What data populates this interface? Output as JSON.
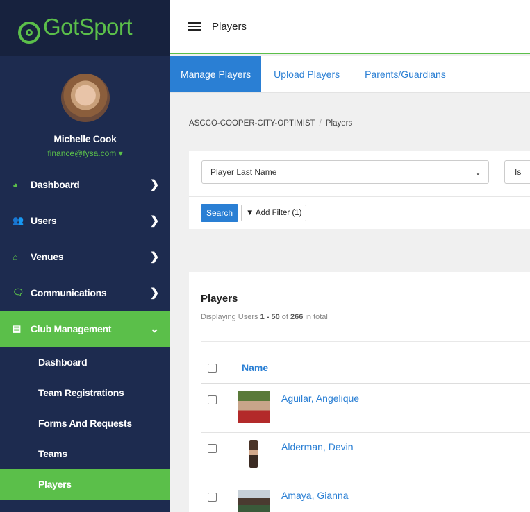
{
  "app": {
    "logo_text": "GotSport"
  },
  "user": {
    "name": "Michelle Cook",
    "email": "finance@fysa.com ▾"
  },
  "sidebar": {
    "items": [
      {
        "label": "Dashboard",
        "icon": "dashboard-icon"
      },
      {
        "label": "Users",
        "icon": "users-icon"
      },
      {
        "label": "Venues",
        "icon": "venues-icon"
      },
      {
        "label": "Communications",
        "icon": "communications-icon"
      },
      {
        "label": "Club Management",
        "icon": "club-management-icon"
      }
    ],
    "sub_items": [
      {
        "label": "Dashboard"
      },
      {
        "label": "Team Registrations"
      },
      {
        "label": "Forms And Requests"
      },
      {
        "label": "Teams"
      },
      {
        "label": "Players"
      }
    ],
    "colors": {
      "bg": "#1d2b4f",
      "accent": "#5bbf4a"
    }
  },
  "header": {
    "title": "Players"
  },
  "tabs": [
    {
      "label": "Manage Players"
    },
    {
      "label": "Upload Players"
    },
    {
      "label": "Parents/Guardians"
    }
  ],
  "breadcrumb": {
    "org": "ASCCO-COOPER-CITY-OPTIMIST",
    "separator": "/",
    "page": "Players"
  },
  "filter": {
    "field_value": "Player Last Name",
    "operator_value": "Is",
    "search_label": "Search",
    "add_filter_label": "Add Filter (1)"
  },
  "players": {
    "title": "Players",
    "summary_prefix": "Displaying Users ",
    "summary_range": "1 - 50",
    "summary_of": " of ",
    "summary_total": "266",
    "summary_suffix": " in total",
    "column_name": "Name",
    "rows": [
      {
        "name": "Aguilar, Angelique"
      },
      {
        "name": "Alderman, Devin"
      },
      {
        "name": "Amaya, Gianna"
      }
    ]
  }
}
